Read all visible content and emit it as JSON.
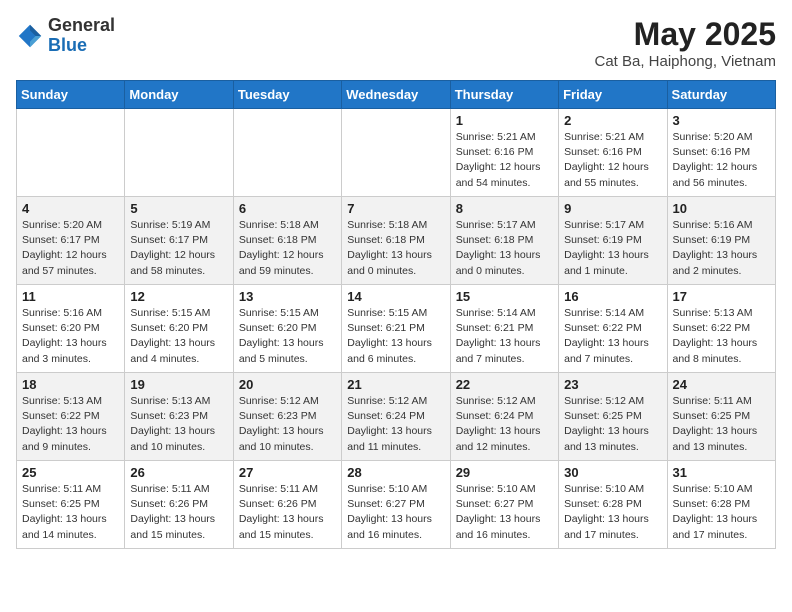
{
  "header": {
    "logo_general": "General",
    "logo_blue": "Blue",
    "month_title": "May 2025",
    "location": "Cat Ba, Haiphong, Vietnam"
  },
  "weekdays": [
    "Sunday",
    "Monday",
    "Tuesday",
    "Wednesday",
    "Thursday",
    "Friday",
    "Saturday"
  ],
  "weeks": [
    [
      {
        "day": "",
        "info": ""
      },
      {
        "day": "",
        "info": ""
      },
      {
        "day": "",
        "info": ""
      },
      {
        "day": "",
        "info": ""
      },
      {
        "day": "1",
        "info": "Sunrise: 5:21 AM\nSunset: 6:16 PM\nDaylight: 12 hours\nand 54 minutes."
      },
      {
        "day": "2",
        "info": "Sunrise: 5:21 AM\nSunset: 6:16 PM\nDaylight: 12 hours\nand 55 minutes."
      },
      {
        "day": "3",
        "info": "Sunrise: 5:20 AM\nSunset: 6:16 PM\nDaylight: 12 hours\nand 56 minutes."
      }
    ],
    [
      {
        "day": "4",
        "info": "Sunrise: 5:20 AM\nSunset: 6:17 PM\nDaylight: 12 hours\nand 57 minutes."
      },
      {
        "day": "5",
        "info": "Sunrise: 5:19 AM\nSunset: 6:17 PM\nDaylight: 12 hours\nand 58 minutes."
      },
      {
        "day": "6",
        "info": "Sunrise: 5:18 AM\nSunset: 6:18 PM\nDaylight: 12 hours\nand 59 minutes."
      },
      {
        "day": "7",
        "info": "Sunrise: 5:18 AM\nSunset: 6:18 PM\nDaylight: 13 hours\nand 0 minutes."
      },
      {
        "day": "8",
        "info": "Sunrise: 5:17 AM\nSunset: 6:18 PM\nDaylight: 13 hours\nand 0 minutes."
      },
      {
        "day": "9",
        "info": "Sunrise: 5:17 AM\nSunset: 6:19 PM\nDaylight: 13 hours\nand 1 minute."
      },
      {
        "day": "10",
        "info": "Sunrise: 5:16 AM\nSunset: 6:19 PM\nDaylight: 13 hours\nand 2 minutes."
      }
    ],
    [
      {
        "day": "11",
        "info": "Sunrise: 5:16 AM\nSunset: 6:20 PM\nDaylight: 13 hours\nand 3 minutes."
      },
      {
        "day": "12",
        "info": "Sunrise: 5:15 AM\nSunset: 6:20 PM\nDaylight: 13 hours\nand 4 minutes."
      },
      {
        "day": "13",
        "info": "Sunrise: 5:15 AM\nSunset: 6:20 PM\nDaylight: 13 hours\nand 5 minutes."
      },
      {
        "day": "14",
        "info": "Sunrise: 5:15 AM\nSunset: 6:21 PM\nDaylight: 13 hours\nand 6 minutes."
      },
      {
        "day": "15",
        "info": "Sunrise: 5:14 AM\nSunset: 6:21 PM\nDaylight: 13 hours\nand 7 minutes."
      },
      {
        "day": "16",
        "info": "Sunrise: 5:14 AM\nSunset: 6:22 PM\nDaylight: 13 hours\nand 7 minutes."
      },
      {
        "day": "17",
        "info": "Sunrise: 5:13 AM\nSunset: 6:22 PM\nDaylight: 13 hours\nand 8 minutes."
      }
    ],
    [
      {
        "day": "18",
        "info": "Sunrise: 5:13 AM\nSunset: 6:22 PM\nDaylight: 13 hours\nand 9 minutes."
      },
      {
        "day": "19",
        "info": "Sunrise: 5:13 AM\nSunset: 6:23 PM\nDaylight: 13 hours\nand 10 minutes."
      },
      {
        "day": "20",
        "info": "Sunrise: 5:12 AM\nSunset: 6:23 PM\nDaylight: 13 hours\nand 10 minutes."
      },
      {
        "day": "21",
        "info": "Sunrise: 5:12 AM\nSunset: 6:24 PM\nDaylight: 13 hours\nand 11 minutes."
      },
      {
        "day": "22",
        "info": "Sunrise: 5:12 AM\nSunset: 6:24 PM\nDaylight: 13 hours\nand 12 minutes."
      },
      {
        "day": "23",
        "info": "Sunrise: 5:12 AM\nSunset: 6:25 PM\nDaylight: 13 hours\nand 13 minutes."
      },
      {
        "day": "24",
        "info": "Sunrise: 5:11 AM\nSunset: 6:25 PM\nDaylight: 13 hours\nand 13 minutes."
      }
    ],
    [
      {
        "day": "25",
        "info": "Sunrise: 5:11 AM\nSunset: 6:25 PM\nDaylight: 13 hours\nand 14 minutes."
      },
      {
        "day": "26",
        "info": "Sunrise: 5:11 AM\nSunset: 6:26 PM\nDaylight: 13 hours\nand 15 minutes."
      },
      {
        "day": "27",
        "info": "Sunrise: 5:11 AM\nSunset: 6:26 PM\nDaylight: 13 hours\nand 15 minutes."
      },
      {
        "day": "28",
        "info": "Sunrise: 5:10 AM\nSunset: 6:27 PM\nDaylight: 13 hours\nand 16 minutes."
      },
      {
        "day": "29",
        "info": "Sunrise: 5:10 AM\nSunset: 6:27 PM\nDaylight: 13 hours\nand 16 minutes."
      },
      {
        "day": "30",
        "info": "Sunrise: 5:10 AM\nSunset: 6:28 PM\nDaylight: 13 hours\nand 17 minutes."
      },
      {
        "day": "31",
        "info": "Sunrise: 5:10 AM\nSunset: 6:28 PM\nDaylight: 13 hours\nand 17 minutes."
      }
    ]
  ]
}
